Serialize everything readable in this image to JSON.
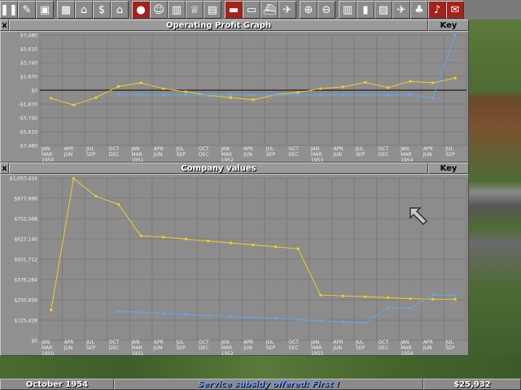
{
  "colors": {
    "profit_line": "#f0d020",
    "company_line": "#f0d020",
    "other_line": "#60a8f0",
    "graph_bg": "#8c8c8c",
    "grid": "#7a7a7a",
    "axis_label": "#f0f0f0"
  },
  "toolbar": {
    "icons": [
      "pause-icon",
      "settings-icon",
      "save-icon",
      "map-icon",
      "town-directory-icon",
      "subsidies-icon",
      "stations-icon",
      "finances-icon",
      "company-icon",
      "graphs-icon",
      "league-icon",
      "industries-icon",
      "train-list-icon",
      "road-vehicles-icon",
      "ships-icon",
      "aircraft-icon",
      "zoom-in-icon",
      "zoom-out-icon",
      "build-rail-icon",
      "build-road-icon",
      "build-docks-icon",
      "build-airport-icon",
      "landscaping-icon",
      "music-icon",
      "messages-icon"
    ]
  },
  "profit_window": {
    "title": "Operating Profit Graph",
    "key_label": "Key",
    "close_label": "x"
  },
  "company_window": {
    "title": "Company values",
    "key_label": "Key",
    "close_label": "x"
  },
  "statusbar": {
    "date": "October 1954",
    "news": "Service subsidy offered:    First !",
    "money": "$25,932"
  },
  "chart_data": [
    {
      "type": "line",
      "title": "Operating Profit Graph",
      "y_ticks": [
        "$7,480",
        "$5,610",
        "$3,740",
        "$1,870",
        "$0",
        "-$1,870",
        "-$3,740",
        "-$5,610",
        "-$7,480"
      ],
      "ylim": [
        -7480,
        7480
      ],
      "x_labels": [
        [
          "JAN",
          "MAR",
          "1950"
        ],
        [
          "APR",
          "JUN",
          ""
        ],
        [
          "JUL",
          "SEP",
          ""
        ],
        [
          "OCT",
          "DEC",
          ""
        ],
        [
          "JAN",
          "MAR",
          "1951"
        ],
        [
          "APR",
          "JUN",
          ""
        ],
        [
          "JUL",
          "SEP",
          ""
        ],
        [
          "OCT",
          "DEC",
          ""
        ],
        [
          "JAN",
          "MAR",
          "1952"
        ],
        [
          "APR",
          "JUN",
          ""
        ],
        [
          "JUL",
          "SEP",
          ""
        ],
        [
          "OCT",
          "DEC",
          ""
        ],
        [
          "JAN",
          "MAR",
          "1953"
        ],
        [
          "APR",
          "JUN",
          ""
        ],
        [
          "JUL",
          "SEP",
          ""
        ],
        [
          "OCT",
          "DEC",
          ""
        ],
        [
          "JAN",
          "MAR",
          "1954"
        ],
        [
          "APR",
          "JUN",
          ""
        ],
        [
          "JUL",
          "SEP",
          ""
        ]
      ],
      "series": [
        {
          "color": "#f0d020",
          "values": [
            -1100,
            -2000,
            -1000,
            500,
            1000,
            200,
            -200,
            -700,
            -1000,
            -1300,
            -600,
            -300,
            200,
            450,
            1050,
            350,
            1200,
            1000,
            1650
          ]
        },
        {
          "color": "#60a8f0",
          "values": [
            null,
            null,
            null,
            -550,
            -650,
            -650,
            -650,
            -650,
            -650,
            -650,
            -650,
            -650,
            -650,
            -650,
            -650,
            -650,
            -600,
            -1050,
            7450
          ]
        }
      ]
    },
    {
      "type": "line",
      "title": "Company values",
      "y_ticks": [
        "$1,003,424",
        "$877,996",
        "$752,568",
        "$627,140",
        "$501,712",
        "$376,284",
        "$250,856",
        "$125,428",
        "$0"
      ],
      "ylim": [
        0,
        1003424
      ],
      "x_labels": [
        [
          "JAN",
          "MAR",
          "1950"
        ],
        [
          "APR",
          "JUN",
          ""
        ],
        [
          "JUL",
          "SEP",
          ""
        ],
        [
          "OCT",
          "DEC",
          ""
        ],
        [
          "JAN",
          "MAR",
          "1951"
        ],
        [
          "APR",
          "JUN",
          ""
        ],
        [
          "JUL",
          "SEP",
          ""
        ],
        [
          "OCT",
          "DEC",
          ""
        ],
        [
          "JAN",
          "MAR",
          "1952"
        ],
        [
          "APR",
          "JUN",
          ""
        ],
        [
          "JUL",
          "SEP",
          ""
        ],
        [
          "OCT",
          "DEC",
          ""
        ],
        [
          "JAN",
          "MAR",
          "1953"
        ],
        [
          "APR",
          "JUN",
          ""
        ],
        [
          "JUL",
          "SEP",
          ""
        ],
        [
          "OCT",
          "DEC",
          ""
        ],
        [
          "JAN",
          "MAR",
          "1954"
        ],
        [
          "APR",
          "JUN",
          ""
        ],
        [
          "JUL",
          "SEP",
          ""
        ]
      ],
      "series": [
        {
          "color": "#f0d020",
          "values": [
            188000,
            1000000,
            890000,
            840000,
            646000,
            638000,
            626000,
            614000,
            602000,
            590000,
            578000,
            566000,
            280000,
            275000,
            270000,
            264000,
            258000,
            254000,
            254000
          ]
        },
        {
          "color": "#60a8f0",
          "values": [
            null,
            null,
            null,
            182000,
            174000,
            166000,
            160000,
            154000,
            148000,
            142000,
            136000,
            128000,
            122000,
            116000,
            108000,
            204000,
            198000,
            282000,
            278000
          ]
        }
      ]
    }
  ]
}
